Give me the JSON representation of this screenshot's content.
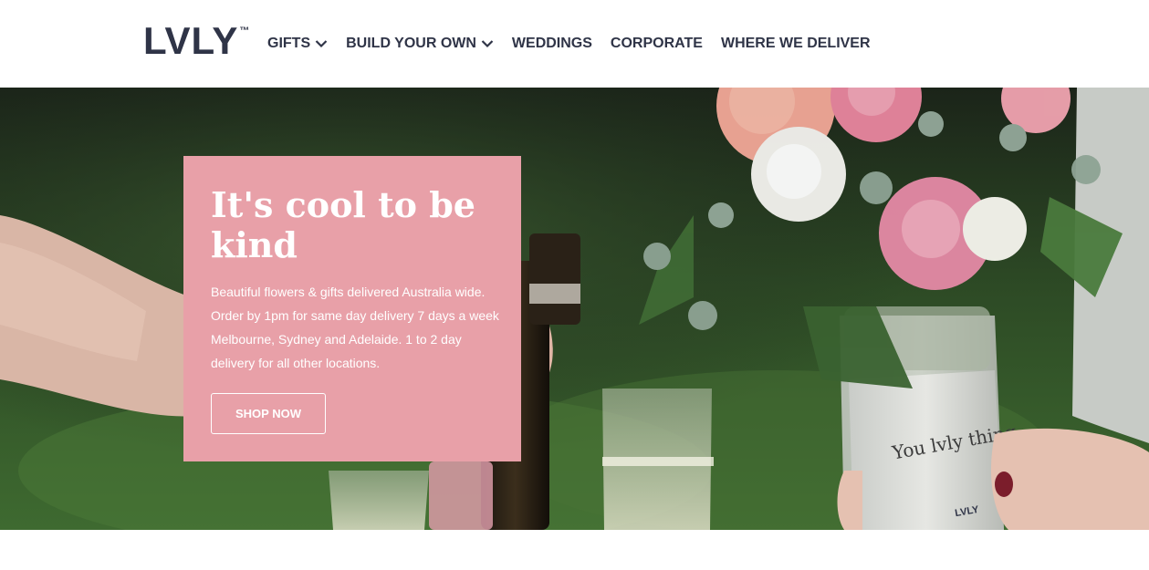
{
  "header": {
    "logo": "LVLY",
    "logo_mark": "™",
    "nav": [
      {
        "label": "GIFTS",
        "has_dropdown": true,
        "icon": "chevron-down-icon"
      },
      {
        "label": "BUILD YOUR OWN",
        "has_dropdown": true,
        "icon": "chevron-down-icon"
      },
      {
        "label": "WEDDINGS",
        "has_dropdown": false
      },
      {
        "label": "CORPORATE",
        "has_dropdown": false
      },
      {
        "label": "WHERE WE DELIVER",
        "has_dropdown": false
      }
    ]
  },
  "hero": {
    "title": "It's cool to be kind",
    "description": "Beautiful flowers & gifts delivered Australia wide. Order by 1pm for same day delivery 7 days a week Melbourne, Sydney and Adelaide. 1 to 2 day delivery for all other locations.",
    "cta_label": "SHOP NOW",
    "jar_label": "You lvly thing.",
    "jar_logo": "LVLY"
  },
  "colors": {
    "brand_text": "#2f3447",
    "promo_pink": "#e8a0a8",
    "white": "#ffffff"
  }
}
